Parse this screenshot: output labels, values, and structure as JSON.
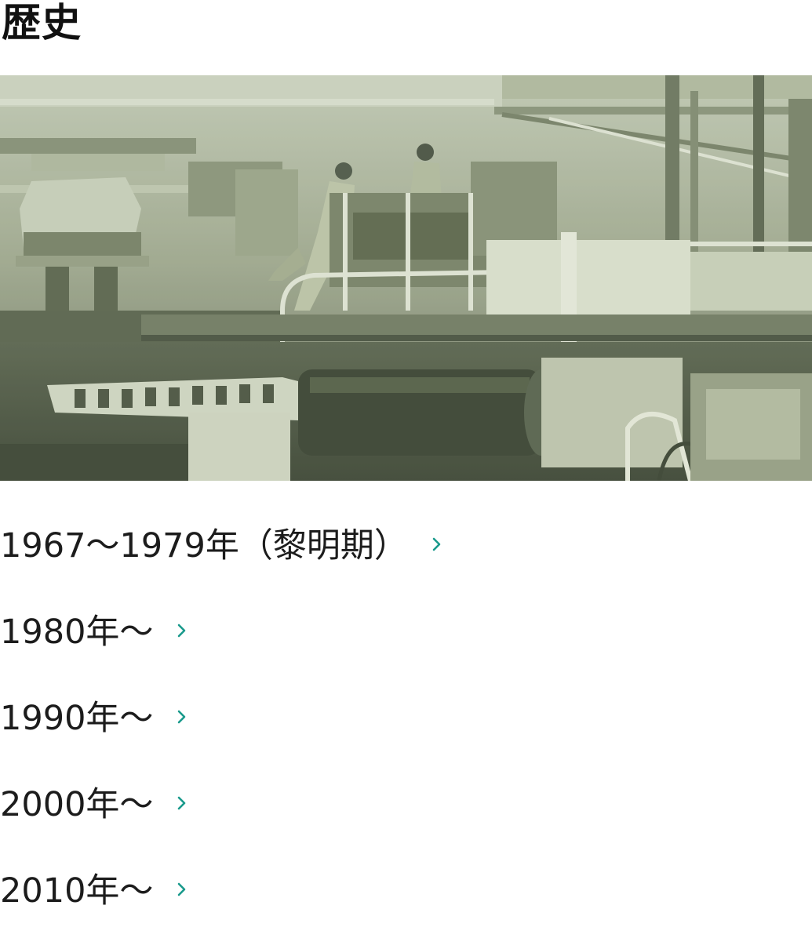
{
  "page": {
    "title": "歴史"
  },
  "hero": {
    "alt": "Historical black-and-white photo of a factory floor with workers and machinery"
  },
  "history": {
    "items": [
      {
        "label": "1967〜1979年（黎明期）",
        "icon": "chevron-right-icon"
      },
      {
        "label": "1980年〜",
        "icon": "chevron-right-icon"
      },
      {
        "label": "1990年〜",
        "icon": "chevron-right-icon"
      },
      {
        "label": "2000年〜",
        "icon": "chevron-right-icon"
      },
      {
        "label": "2010年〜",
        "icon": "chevron-right-icon"
      }
    ]
  },
  "colors": {
    "accent": "#1a9a8c",
    "text": "#1c1c1c",
    "photo_tint": "#9ea88f"
  }
}
